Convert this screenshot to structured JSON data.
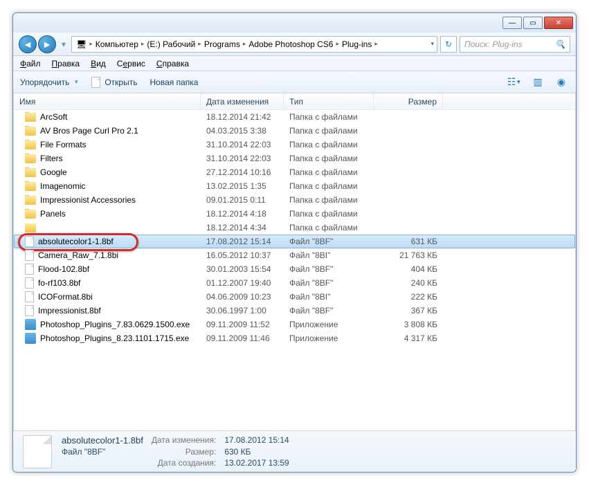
{
  "titlebar": {
    "min": "—",
    "max": "▭",
    "close": "✕"
  },
  "breadcrumb": [
    {
      "label": "Компьютер"
    },
    {
      "label": "(E:) Рабочий"
    },
    {
      "label": "Programs"
    },
    {
      "label": "Adobe Photoshop CS6"
    },
    {
      "label": "Plug-ins"
    }
  ],
  "search_placeholder": "Поиск: Plug-ins",
  "menubar": {
    "file": "Файл",
    "edit": "Правка",
    "view": "Вид",
    "tools": "Сервис",
    "help": "Справка"
  },
  "toolbar": {
    "organize": "Упорядочить",
    "open": "Открыть",
    "newfolder": "Новая папка"
  },
  "columns": {
    "name": "Имя",
    "date": "Дата изменения",
    "type": "Тип",
    "size": "Размер"
  },
  "rows": [
    {
      "icon": "folder",
      "name": "ArcSoft",
      "date": "18.12.2014 21:42",
      "type": "Папка с файлами",
      "size": ""
    },
    {
      "icon": "folder",
      "name": "AV Bros Page Curl Pro 2.1",
      "date": "04.03.2015 3:38",
      "type": "Папка с файлами",
      "size": ""
    },
    {
      "icon": "folder",
      "name": "File Formats",
      "date": "31.10.2014 22:03",
      "type": "Папка с файлами",
      "size": ""
    },
    {
      "icon": "folder",
      "name": "Filters",
      "date": "31.10.2014 22:03",
      "type": "Папка с файлами",
      "size": ""
    },
    {
      "icon": "folder",
      "name": "Google",
      "date": "27.12.2014 10:16",
      "type": "Папка с файлами",
      "size": ""
    },
    {
      "icon": "folder",
      "name": "Imagenomic",
      "date": "13.02.2015 1:35",
      "type": "Папка с файлами",
      "size": ""
    },
    {
      "icon": "folder",
      "name": "Impressionist Accessories",
      "date": "09.01.2015 0:11",
      "type": "Папка с файлами",
      "size": ""
    },
    {
      "icon": "folder",
      "name": "Panels",
      "date": "18.12.2014 4:18",
      "type": "Папка с файлами",
      "size": ""
    },
    {
      "icon": "folder",
      "name": "",
      "date": "18.12.2014 4:34",
      "type": "Папка с файлами",
      "size": ""
    },
    {
      "icon": "file",
      "name": "absolutecolor1-1.8bf",
      "date": "17.08.2012 15:14",
      "type": "Файл \"8BF\"",
      "size": "631 КБ",
      "selected": true
    },
    {
      "icon": "file",
      "name": "Camera_Raw_7.1.8bi",
      "date": "16.05.2012 10:37",
      "type": "Файл \"8BI\"",
      "size": "21 763 КБ"
    },
    {
      "icon": "file",
      "name": "Flood-102.8bf",
      "date": "30.01.2003 15:54",
      "type": "Файл \"8BF\"",
      "size": "404 КБ"
    },
    {
      "icon": "file",
      "name": "fo-rf103.8bf",
      "date": "01.12.2007 19:40",
      "type": "Файл \"8BF\"",
      "size": "240 КБ"
    },
    {
      "icon": "file",
      "name": "ICOFormat.8bi",
      "date": "04.06.2009 10:23",
      "type": "Файл \"8BI\"",
      "size": "222 КБ"
    },
    {
      "icon": "file",
      "name": "Impressionist.8bf",
      "date": "30.06.1997 1:00",
      "type": "Файл \"8BF\"",
      "size": "367 КБ"
    },
    {
      "icon": "exe",
      "name": "Photoshop_Plugins_7.83.0629.1500.exe",
      "date": "09.11.2009 11:52",
      "type": "Приложение",
      "size": "3 808 КБ"
    },
    {
      "icon": "exe",
      "name": "Photoshop_Plugins_8.23.1101.1715.exe",
      "date": "09.11.2009 11:46",
      "type": "Приложение",
      "size": "4 317 КБ"
    }
  ],
  "details": {
    "name": "absolutecolor1-1.8bf",
    "type": "Файл \"8BF\"",
    "date_label": "Дата изменения:",
    "date": "17.08.2012 15:14",
    "size_label": "Размер:",
    "size": "630 КБ",
    "created_label": "Дата создания:",
    "created": "13.02.2017 13:59"
  }
}
